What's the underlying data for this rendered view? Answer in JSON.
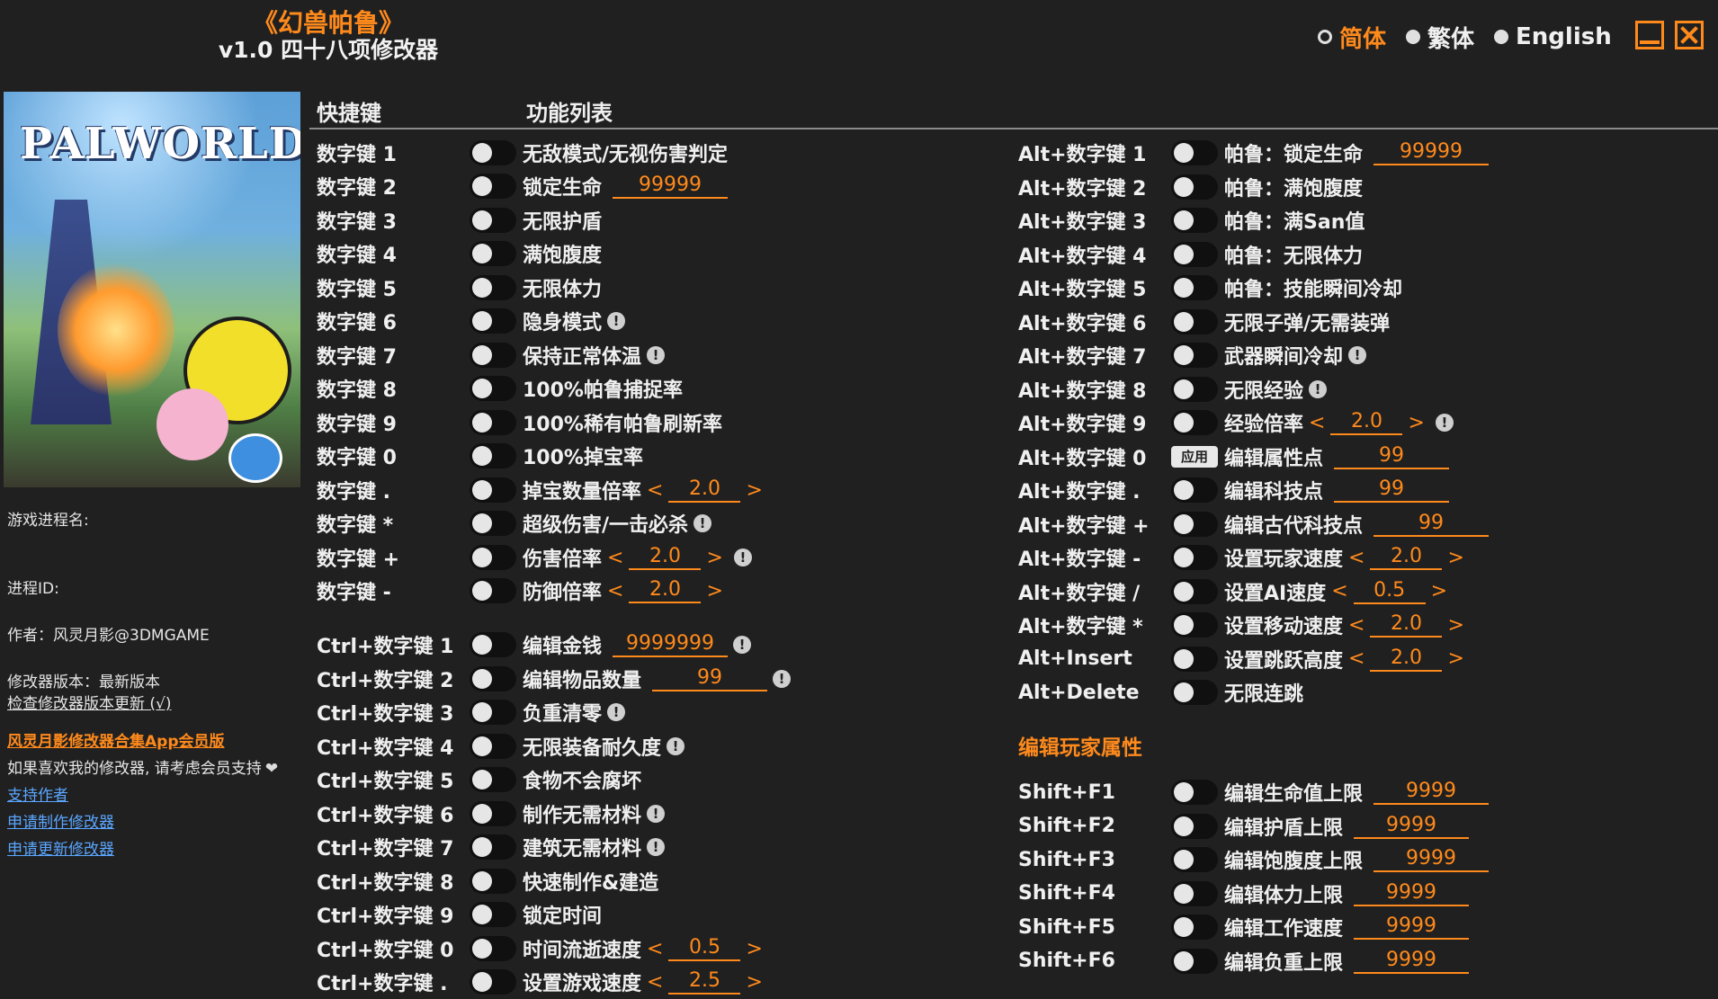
{
  "title": {
    "game": "《幻兽帕鲁》",
    "version": "v1.0 四十八项修改器"
  },
  "languages": [
    {
      "label": "简体",
      "selected": true
    },
    {
      "label": "繁体",
      "selected": false
    },
    {
      "label": "English",
      "selected": false
    }
  ],
  "cover": {
    "logo_text": "PALWORLD"
  },
  "info": {
    "process_name_label": "游戏进程名:",
    "process_id_label": "进程ID:",
    "author": "作者：风灵月影@3DMGAME",
    "trainer_version": "修改器版本：最新版本",
    "check_update": "检查修改器版本更新 (√)",
    "promo_link": "风灵月影修改器合集App会员版",
    "support_text": "如果喜欢我的修改器, 请考虑会员支持",
    "support_author": "支持作者",
    "request_make": "申请制作修改器",
    "request_update": "申请更新修改器"
  },
  "headers": {
    "hotkey": "快捷键",
    "features": "功能列表"
  },
  "left_features": [
    {
      "key": "数字键 1",
      "label": "无敌模式/无视伤害判定"
    },
    {
      "key": "数字键 2",
      "label": "锁定生命",
      "value": "99999"
    },
    {
      "key": "数字键 3",
      "label": "无限护盾"
    },
    {
      "key": "数字键 4",
      "label": "满饱腹度"
    },
    {
      "key": "数字键 5",
      "label": "无限体力"
    },
    {
      "key": "数字键 6",
      "label": "隐身模式",
      "warn": "!"
    },
    {
      "key": "数字键 7",
      "label": "保持正常体温",
      "warn": "!"
    },
    {
      "key": "数字键 8",
      "label": "100%帕鲁捕捉率"
    },
    {
      "key": "数字键 9",
      "label": "100%稀有帕鲁刷新率"
    },
    {
      "key": "数字键 0",
      "label": "100%掉宝率"
    },
    {
      "key": "数字键 .",
      "label": "掉宝数量倍率",
      "stepper": "2.0"
    },
    {
      "key": "数字键 *",
      "label": "超级伤害/一击必杀",
      "warn": "!"
    },
    {
      "key": "数字键 +",
      "label": "伤害倍率",
      "stepper": "2.0",
      "warn": "!"
    },
    {
      "key": "数字键 -",
      "label": "防御倍率",
      "stepper": "2.0"
    },
    {
      "key": "Ctrl+数字键 1",
      "label": "编辑金钱",
      "value": "9999999",
      "warn": "!"
    },
    {
      "key": "Ctrl+数字键 2",
      "label": "编辑物品数量",
      "value": "99",
      "warn": "!"
    },
    {
      "key": "Ctrl+数字键 3",
      "label": "负重清零",
      "warn": "!"
    },
    {
      "key": "Ctrl+数字键 4",
      "label": "无限装备耐久度",
      "warn": "!"
    },
    {
      "key": "Ctrl+数字键 5",
      "label": "食物不会腐坏"
    },
    {
      "key": "Ctrl+数字键 6",
      "label": "制作无需材料",
      "warn": "!"
    },
    {
      "key": "Ctrl+数字键 7",
      "label": "建筑无需材料",
      "warn": "!"
    },
    {
      "key": "Ctrl+数字键 8",
      "label": "快速制作&建造"
    },
    {
      "key": "Ctrl+数字键 9",
      "label": "锁定时间"
    },
    {
      "key": "Ctrl+数字键 0",
      "label": "时间流逝速度",
      "stepper": "0.5"
    },
    {
      "key": "Ctrl+数字键 .",
      "label": "设置游戏速度",
      "stepper": "2.5"
    }
  ],
  "right_features": [
    {
      "key": "Alt+数字键 1",
      "label": "帕鲁：锁定生命",
      "value": "99999"
    },
    {
      "key": "Alt+数字键 2",
      "label": "帕鲁：满饱腹度"
    },
    {
      "key": "Alt+数字键 3",
      "label": "帕鲁：满San值"
    },
    {
      "key": "Alt+数字键 4",
      "label": "帕鲁：无限体力"
    },
    {
      "key": "Alt+数字键 5",
      "label": "帕鲁：技能瞬间冷却"
    },
    {
      "key": "Alt+数字键 6",
      "label": "无限子弹/无需装弹"
    },
    {
      "key": "Alt+数字键 7",
      "label": "武器瞬间冷却",
      "warn": "!"
    },
    {
      "key": "Alt+数字键 8",
      "label": "无限经验",
      "warn": "!"
    },
    {
      "key": "Alt+数字键 9",
      "label": "经验倍率",
      "stepper": "2.0",
      "warn": "!"
    },
    {
      "key": "Alt+数字键 0",
      "label": "编辑属性点",
      "value": "99",
      "apply": "应用"
    },
    {
      "key": "Alt+数字键 .",
      "label": "编辑科技点",
      "value": "99"
    },
    {
      "key": "Alt+数字键 +",
      "label": "编辑古代科技点",
      "value": "99"
    },
    {
      "key": "Alt+数字键 -",
      "label": "设置玩家速度",
      "stepper": "2.0"
    },
    {
      "key": "Alt+数字键 /",
      "label": "设置AI速度",
      "stepper": "0.5"
    },
    {
      "key": "Alt+数字键 *",
      "label": "设置移动速度",
      "stepper": "2.0"
    },
    {
      "key": "Alt+Insert",
      "label": "设置跳跃高度",
      "stepper": "2.0"
    },
    {
      "key": "Alt+Delete",
      "label": "无限连跳"
    }
  ],
  "player_section": {
    "title": "编辑玩家属性",
    "items": [
      {
        "key": "Shift+F1",
        "label": "编辑生命值上限",
        "value": "9999"
      },
      {
        "key": "Shift+F2",
        "label": "编辑护盾上限",
        "value": "9999"
      },
      {
        "key": "Shift+F3",
        "label": "编辑饱腹度上限",
        "value": "9999"
      },
      {
        "key": "Shift+F4",
        "label": "编辑体力上限",
        "value": "9999"
      },
      {
        "key": "Shift+F5",
        "label": "编辑工作速度",
        "value": "9999"
      },
      {
        "key": "Shift+F6",
        "label": "编辑负重上限",
        "value": "9999"
      }
    ]
  },
  "arrows": {
    "left": "<",
    "right": ">"
  },
  "colors": {
    "accent": "#ff8a1c",
    "background": "#202020",
    "text": "#f0f0f0",
    "link": "#5aa6ff"
  }
}
